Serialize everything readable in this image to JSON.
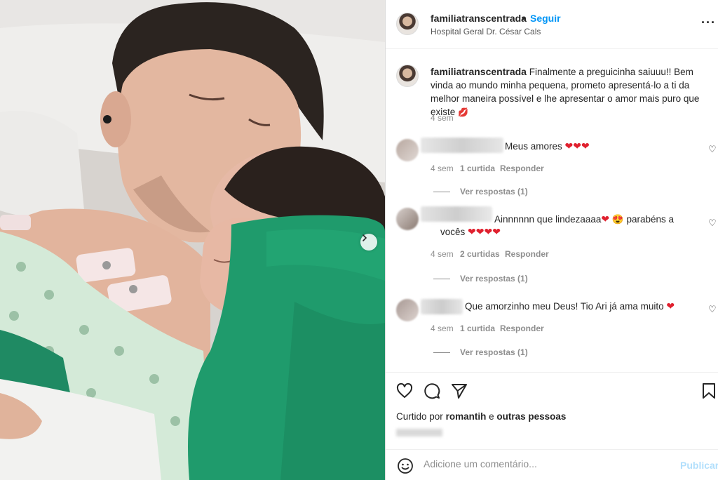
{
  "post": {
    "username": "familiatranscentrada",
    "follow_label": "Seguir",
    "dot": "•",
    "location": "Hospital Geral Dr. César Cals",
    "more_label": "···",
    "caption_text": "Finalmente a preguicinha saiuuu!! Bem vinda ao mundo minha pequena, prometo apresentá-lo a ti da melhor maneira possível e lhe apresentar o amor mais puro que existe",
    "caption_time": "4 sem",
    "caption_emoji": "💋"
  },
  "comments": [
    {
      "text": "Meus amores",
      "hearts": "❤❤❤",
      "time": "4 sem",
      "likes": "1 curtida",
      "reply": "Responder",
      "view_replies": "Ver respostas (1)"
    },
    {
      "text": "Ainnnnnn que lindezaaaa",
      "heart1": "❤",
      "emoji": "😍",
      "text2": "parabéns a",
      "text3": "vocês",
      "hearts": "❤❤❤❤",
      "time": "4 sem",
      "likes": "2 curtidas",
      "reply": "Responder",
      "view_replies": "Ver respostas (1)"
    },
    {
      "text": "Que amorzinho meu Deus! Tio Ari já ama muito",
      "hearts": "❤",
      "time": "4 sem",
      "likes": "1 curtida",
      "reply": "Responder",
      "view_replies": "Ver respostas (1)"
    }
  ],
  "likes": {
    "prefix": "Curtido por",
    "user": "romantih",
    "conj": "e",
    "others": "outras pessoas"
  },
  "add_comment": {
    "placeholder": "Adicione um comentário...",
    "publish_label": "Publicar"
  },
  "icons": {
    "like": "heart-icon",
    "comment": "comment-icon",
    "share": "share-icon",
    "save": "bookmark-icon",
    "emoji": "emoji-icon",
    "next": "chevron-right-icon"
  },
  "colors": {
    "accent": "#0095f6",
    "publish_disabled": "#b2dffc",
    "heart": "#e0202e",
    "muted": "#8e8e8e"
  }
}
